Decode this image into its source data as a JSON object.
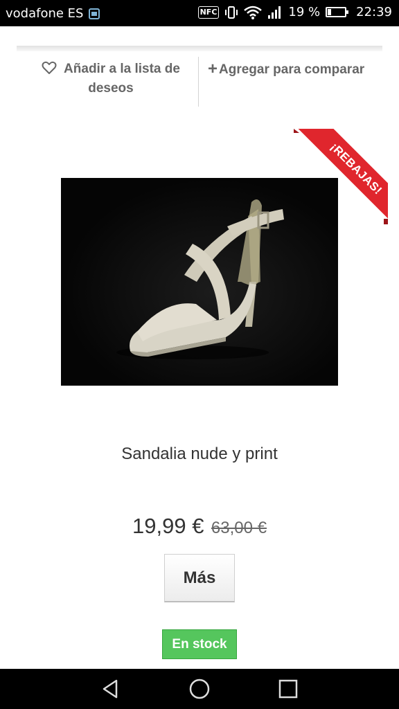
{
  "status_bar": {
    "carrier": "vodafone ES",
    "nfc_label": "NFC",
    "battery": "19 %",
    "time": "22:39",
    "icons": [
      "image-notification-icon",
      "nfc-icon",
      "vibrate-icon",
      "wifi-icon",
      "signal-icon",
      "battery-icon"
    ]
  },
  "actions": {
    "wishlist_label": "Añadir a la lista de deseos",
    "compare_label": "Agregar para comparar",
    "compare_icon": "+"
  },
  "product": {
    "badge": "¡REBAJAS!",
    "name": "Sandalia nude y print",
    "price": "19,99 €",
    "old_price": "63,00 €",
    "more_button": "Más",
    "stock": "En stock"
  },
  "colors": {
    "sale_ribbon": "#e0262d",
    "stock_badge": "#55c65d",
    "text": "#333333"
  }
}
